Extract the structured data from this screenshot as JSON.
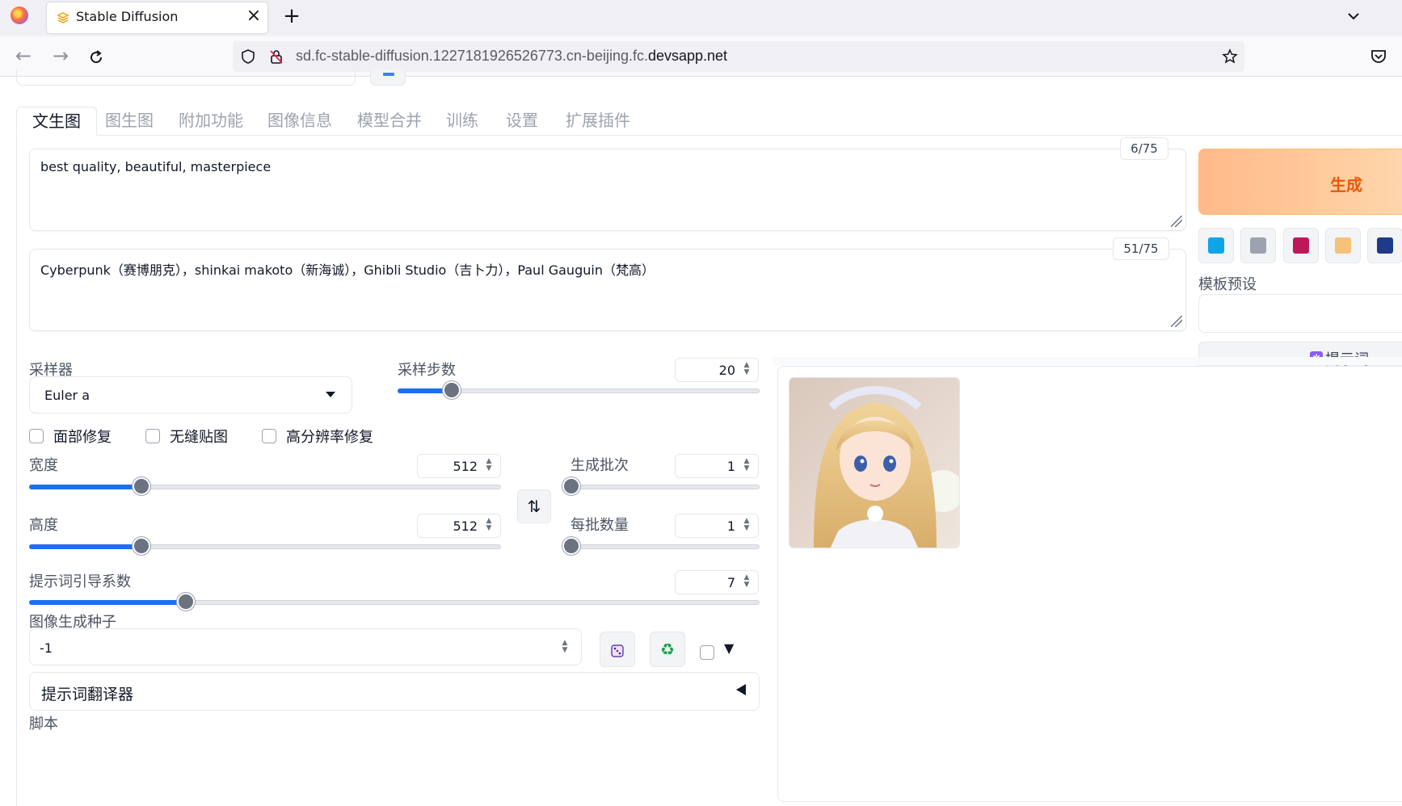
{
  "browser": {
    "tab_title": "Stable Diffusion",
    "url_prefix": "sd.fc-stable-diffusion.1227181926526773.cn-beijing.fc.",
    "url_domain": "devsapp.net"
  },
  "tabs": [
    "文生图",
    "图生图",
    "附加功能",
    "图像信息",
    "模型合并",
    "训练",
    "设置",
    "扩展插件"
  ],
  "prompt": {
    "positive": "best quality, beautiful, masterpiece",
    "positive_count": "6/75",
    "negative": "Cyberpunk（赛博朋克），shinkai makoto（新海诚），Ghibli Studio（吉卜力），Paul Gauguin（梵高）",
    "negative_count": "51/75"
  },
  "actions": {
    "generate": "生成",
    "style_label": "模板预设",
    "prompt_button": "提示词"
  },
  "sampler": {
    "label": "采样器",
    "value": "Euler a"
  },
  "steps": {
    "label": "采样步数",
    "value": "20",
    "fraction": 0.148
  },
  "checkboxes": [
    "面部修复",
    "无缝贴图",
    "高分辨率修复"
  ],
  "width": {
    "label": "宽度",
    "value": "512",
    "fraction": 0.237
  },
  "height": {
    "label": "高度",
    "value": "512",
    "fraction": 0.237
  },
  "batch_count": {
    "label": "生成批次",
    "value": "1",
    "fraction": 0.0
  },
  "batch_size": {
    "label": "每批数量",
    "value": "1",
    "fraction": 0.0
  },
  "cfg": {
    "label": "提示词引导系数",
    "value": "7",
    "fraction": 0.214
  },
  "seed": {
    "label": "图像生成种子",
    "value": "-1"
  },
  "translator": {
    "label": "提示词翻译器"
  },
  "script": {
    "label": "脚本"
  },
  "colors": {
    "accent": "#1d6ff2",
    "generate": "#ea580c"
  }
}
